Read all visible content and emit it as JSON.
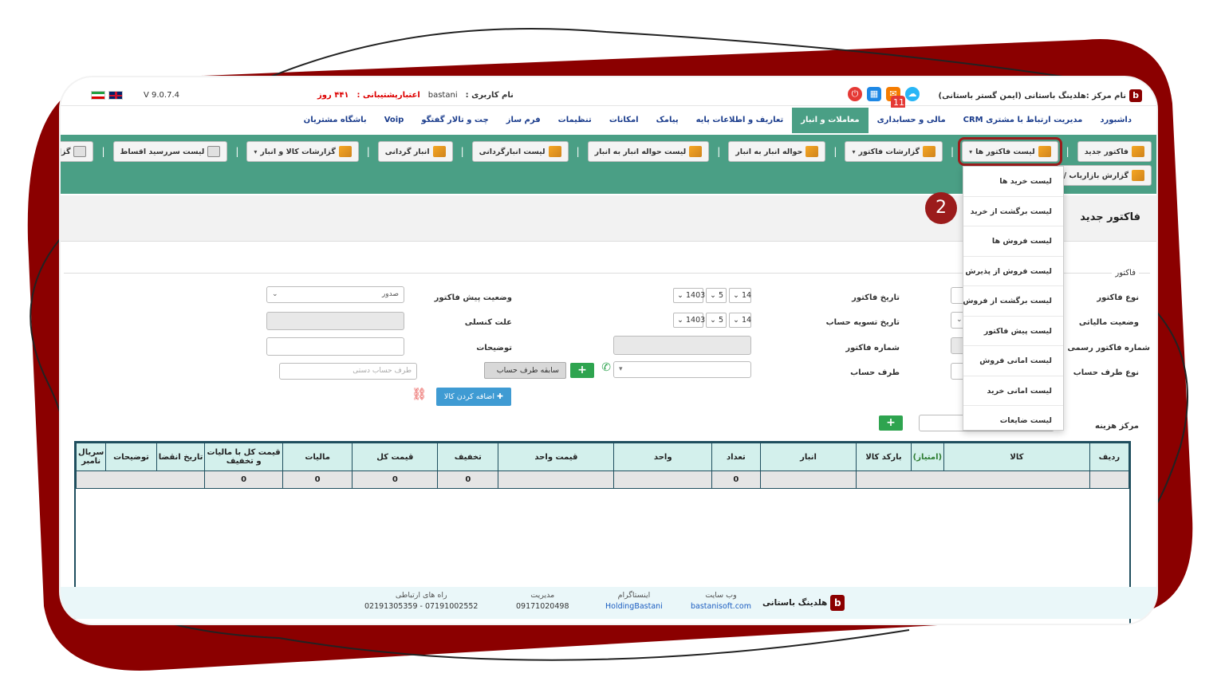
{
  "topbar": {
    "center_name": "نام مرکز :هلدینگ باستانی (ایمن گستر باستانی)",
    "badge_count": "115",
    "username_label": "نام کاربری :",
    "username": "bastani",
    "support_label": "اعتبارپشتیبانی :",
    "support_days": "۴۴۱ روز",
    "version": "V 9.0.7.4"
  },
  "mainnav": {
    "items": [
      "داشبورد",
      "مدیریت ارتباط با مشتری CRM",
      "مالی و حسابداری",
      "معاملات و انبار",
      "تعاریف و اطلاعات پایه",
      "پیامک",
      "امکانات",
      "تنظیمات",
      "فرم ساز",
      "چت و تالار گفتگو",
      "Voip",
      "باشگاه مشتریان"
    ],
    "active": "معاملات و انبار"
  },
  "toolbar": {
    "row1": [
      {
        "label": "فاکتور جدید",
        "dropdown": false
      },
      {
        "label": "لیست فاکتور ها",
        "dropdown": true
      },
      {
        "label": "گزارشات فاکتور",
        "dropdown": true
      },
      {
        "label": "حواله انبار به انبار",
        "dropdown": false
      },
      {
        "label": "لیست حواله انبار به انبار",
        "dropdown": false
      },
      {
        "label": "لیست انبارگردانی",
        "dropdown": false
      },
      {
        "label": "انبار گردانی",
        "dropdown": false
      },
      {
        "label": "گزارشات کالا و انبار",
        "dropdown": true
      },
      {
        "label": "لیست سررسید اقساط",
        "dropdown": false
      },
      {
        "label": "گزارش حساب های سررسید شده",
        "dropdown": false
      }
    ],
    "row2": [
      {
        "label": "گزارش بازاریاب /",
        "dropdown": false
      }
    ]
  },
  "dropdown_menu": {
    "items": [
      "لیست خرید ها",
      "لیست برگشت از خرید",
      "لیست فروش ها",
      "لیست فروش از پذیرش",
      "لیست برگشت از فروش",
      "لیست پیش فاکتور",
      "لیست امانی فروش",
      "لیست امانی خرید",
      "لیست ضایعات"
    ]
  },
  "step_marker": "2",
  "page": {
    "title": "فاکتور جدید"
  },
  "form": {
    "legend": "فاکتور",
    "labels": {
      "invoice_type": "نوع فاکتور",
      "tax_status": "وضعیت مالیاتی",
      "official_no": "شماره فاکتور رسمی",
      "party_type": "نوع طرف حساب",
      "invoice_date": "تاریخ فاکتور",
      "settle_date": "تاریخ تسویه حساب",
      "invoice_no": "شماره فاکتور",
      "party": "طرف حساب",
      "pre_status": "وضعیت پیش فاکتور",
      "cancel_reason": "علت کنسلی",
      "description": "توضیحات",
      "cost_center": "مرکز هزینه"
    },
    "invoice_date": {
      "day": "14",
      "month": "5",
      "year": "1403"
    },
    "settle_date": {
      "day": "14",
      "month": "5",
      "year": "1403"
    },
    "pre_status_value": "صدور",
    "manual_party_placeholder": "طرف حساب دستی",
    "party_history_button": "سابقه طرف حساب",
    "add_button": "+",
    "add_item_button": "اضافه کردن کالا"
  },
  "grid": {
    "headers": [
      "ردیف",
      "کالا",
      "(امتیاز)",
      "بارکد کالا",
      "انبار",
      "تعداد",
      "واحد",
      "قیمت واحد",
      "تخفیف",
      "قیمت کل",
      "مالیات",
      "قیمت کل با مالیات و تخفیف",
      "تاریخ انقضا",
      "توضیحات",
      "سریال نامبر"
    ],
    "totals": {
      "count": "0",
      "discount": "0",
      "total": "0",
      "tax": "0",
      "grand_total": "0"
    }
  },
  "footer": {
    "brand": "هلدینگ باستانی",
    "website_label": "وب سایت",
    "website": "bastanisoft.com",
    "instagram_label": "اینستاگرام",
    "instagram": "HoldingBastani",
    "manager_label": "مدیریت",
    "manager_phone": "09171020498",
    "contact_label": "راه های ارتباطی",
    "contact_phones": "07191002552 - 02191305359"
  }
}
